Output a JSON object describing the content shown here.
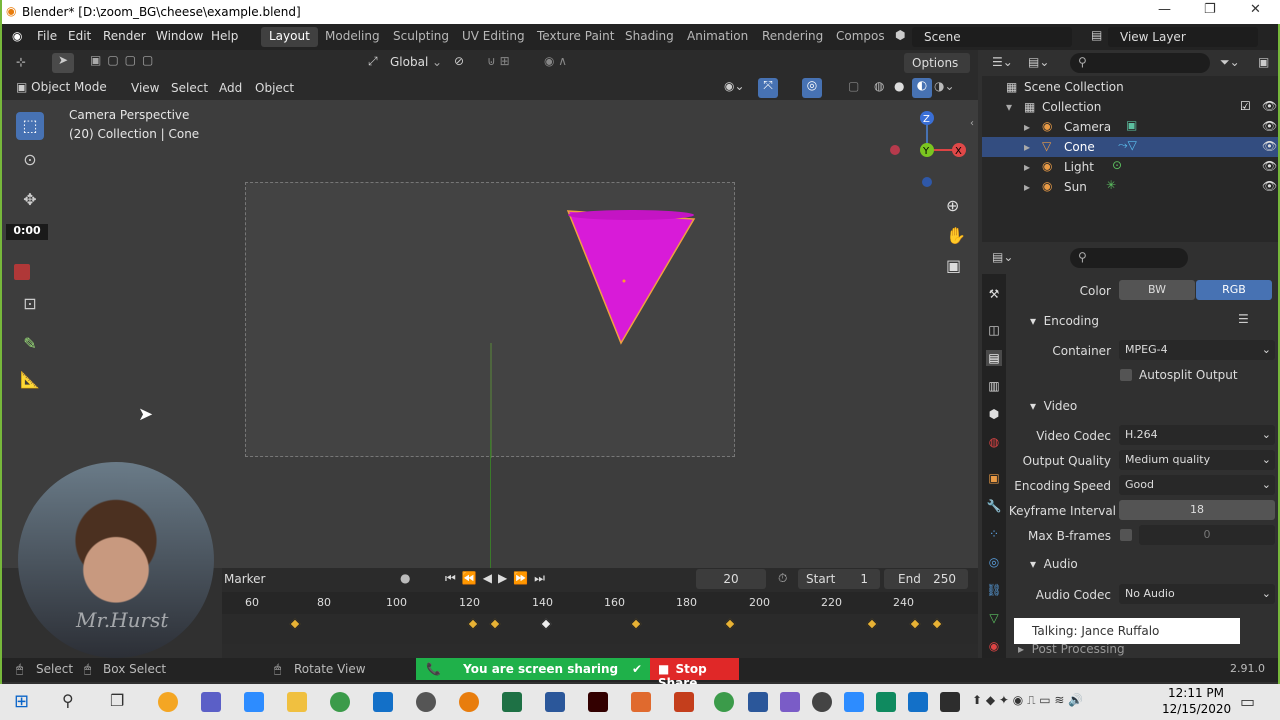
{
  "window": {
    "title": "Blender* [D:\\zoom_BG\\cheese\\example.blend]",
    "controls": {
      "minimize": "—",
      "maximize": "❐",
      "close": "✕"
    }
  },
  "menu": {
    "items": [
      "File",
      "Edit",
      "Render",
      "Window",
      "Help"
    ],
    "workspaces": [
      "Layout",
      "Modeling",
      "Sculpting",
      "UV Editing",
      "Texture Paint",
      "Shading",
      "Animation",
      "Rendering",
      "Compos"
    ],
    "active_workspace": "Layout",
    "scene": "Scene",
    "view_layer": "View Layer"
  },
  "header": {
    "transform_orientation": "Global",
    "options": "Options",
    "mode": "Object Mode",
    "view_menu": [
      "View",
      "Select",
      "Add",
      "Object"
    ]
  },
  "viewport": {
    "overlay_title": "Camera Perspective",
    "overlay_sub": "(20) Collection | Cone",
    "gizmo": {
      "z": "Z",
      "y": "Y",
      "x": "X"
    },
    "timer": "0:00"
  },
  "timeline": {
    "marker": "Marker",
    "current_frame": "20",
    "start_label": "Start",
    "start": "1",
    "end_label": "End",
    "end": "250",
    "ticks": [
      "60",
      "80",
      "100",
      "120",
      "140",
      "160",
      "180",
      "200",
      "220",
      "240"
    ]
  },
  "outliner": {
    "root": "Scene Collection",
    "collection": "Collection",
    "items": [
      "Camera",
      "Cone",
      "Light",
      "Sun"
    ],
    "selected": "Cone"
  },
  "properties": {
    "color_label": "Color",
    "color_bw": "BW",
    "color_rgb": "RGB",
    "encoding": "Encoding",
    "container_label": "Container",
    "container": "MPEG-4",
    "autosplit": "Autosplit Output",
    "video": "Video",
    "video_codec_label": "Video Codec",
    "video_codec": "H.264",
    "output_quality_label": "Output Quality",
    "output_quality": "Medium quality",
    "encoding_speed_label": "Encoding Speed",
    "encoding_speed": "Good",
    "keyframe_interval_label": "Keyframe Interval",
    "keyframe_interval": "18",
    "max_bframes_label": "Max B-frames",
    "max_bframes": "0",
    "audio": "Audio",
    "audio_codec_label": "Audio Codec",
    "audio_codec": "No Audio",
    "post_processing": "Post Processing"
  },
  "statusbar": {
    "select": "Select",
    "box_select": "Box Select",
    "rotate_view": "Rotate View",
    "version": "2.91.0"
  },
  "zoom": {
    "sharing": "You are screen sharing",
    "stop_share": "Stop Share",
    "talking": "Talking: Jance Ruffalo",
    "webcam_text": "Mr.Hurst"
  },
  "taskbar": {
    "time": "12:11 PM",
    "date": "12/15/2020"
  },
  "colors": {
    "accent": "#4772b3",
    "cone": "#d81bd8",
    "keyframe": "#e8b234",
    "zoom_green": "#1fb14a",
    "zoom_red": "#e02828"
  }
}
